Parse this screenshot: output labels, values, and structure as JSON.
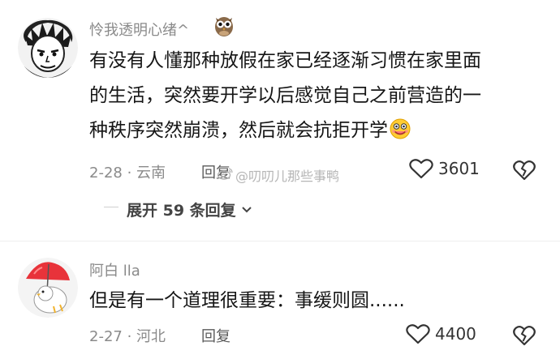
{
  "comments": [
    {
      "username": "怜我透明心绪^",
      "content_line1": "有没有人懂那种放假在家已经逐渐习惯在家里面",
      "content_line2": "的生活，突然要开学以后感觉自己之前营造的一",
      "content_line3": "种秩序突然崩溃，然后就会抗拒开学",
      "date_location": "2-28 · 云南",
      "reply_label": "回复",
      "likes": "3601",
      "expand_label": "展开 59 条回复",
      "avatar_icon": "cartoon-face-avatar",
      "badge_icon": "owl-icon"
    },
    {
      "username": "阿白 lla",
      "content": "但是有一个道理很重要：事缓则圆......",
      "date_location": "2-27 · 河北",
      "reply_label": "回复",
      "likes": "4400",
      "avatar_icon": "umbrella-duck-avatar"
    }
  ],
  "watermark": "@叨叨儿那些事鸭",
  "colors": {
    "text": "#161616",
    "meta": "#8a8a8a",
    "bg": "#ffffff"
  }
}
